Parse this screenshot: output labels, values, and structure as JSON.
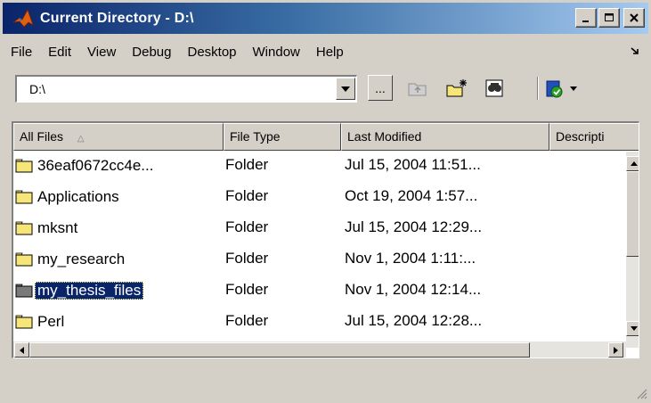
{
  "window": {
    "title": "Current Directory - D:\\",
    "controls": [
      "minimize",
      "maximize",
      "close"
    ]
  },
  "menu": [
    "File",
    "Edit",
    "View",
    "Debug",
    "Desktop",
    "Window",
    "Help"
  ],
  "toolbar": {
    "path_value": "D:\\",
    "browse_label": "...",
    "icons": [
      "up-folder-icon",
      "new-folder-icon",
      "find-files-icon",
      "run-icon"
    ]
  },
  "file_list": {
    "columns": [
      "All Files",
      "File Type",
      "Last Modified",
      "Descripti"
    ],
    "sort_column": "All Files",
    "rows": [
      {
        "name": "36eaf0672cc4e...",
        "type": "Folder",
        "modified": "Jul 15, 2004 11:51..."
      },
      {
        "name": "Applications",
        "type": "Folder",
        "modified": "Oct 19, 2004 1:57..."
      },
      {
        "name": "mksnt",
        "type": "Folder",
        "modified": "Jul 15, 2004 12:29..."
      },
      {
        "name": "my_research",
        "type": "Folder",
        "modified": "Nov 1, 2004 1:11:..."
      },
      {
        "name": "my_thesis_files",
        "type": "Folder",
        "modified": "Nov 1, 2004 12:14...",
        "selected": true
      },
      {
        "name": "Perl",
        "type": "Folder",
        "modified": "Jul 15, 2004 12:28..."
      }
    ]
  },
  "colors": {
    "titlebar_start": "#0a246a",
    "titlebar_end": "#a6caf0",
    "selection": "#0a246a",
    "folder_yellow": "#f6e67a",
    "window_bg": "#d4d0c8"
  }
}
